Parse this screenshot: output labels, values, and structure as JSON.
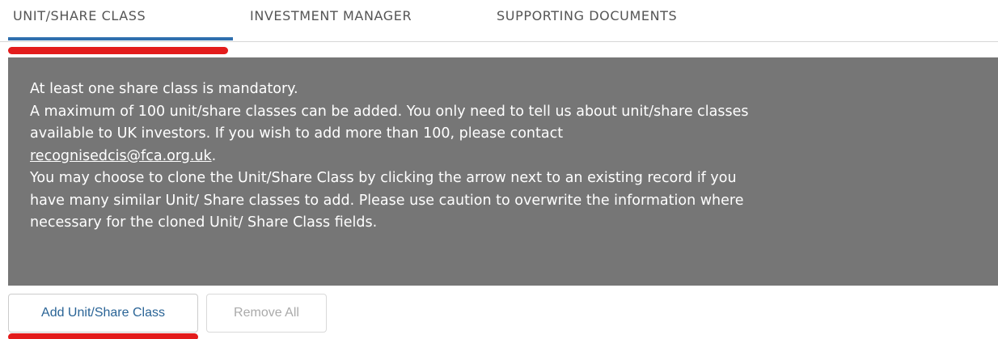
{
  "tabs": {
    "items": [
      {
        "label": "UNIT/SHARE CLASS",
        "active": true
      },
      {
        "label": "INVESTMENT MANAGER",
        "active": false
      },
      {
        "label": "SUPPORTING DOCUMENTS",
        "active": false
      }
    ]
  },
  "info": {
    "line1": "At least one share class is mandatory.",
    "line2": "A maximum of 100 unit/share classes can be added. You only need to tell us about unit/share classes",
    "line3": "available to UK investors. If you wish to add more than 100, please contact",
    "email": "recognisedcis@fca.org.uk",
    "email_suffix": ".",
    "line5": "You may choose to clone the Unit/Share Class by clicking the arrow next to an existing record if you",
    "line6": "have many similar Unit/ Share classes to add. Please use caution to overwrite the information where",
    "line7": "necessary for the cloned Unit/ Share Class fields."
  },
  "buttons": {
    "add_label": "Add Unit/Share Class",
    "remove_label": "Remove All"
  },
  "colors": {
    "active_tab_indicator": "#2f6fae",
    "annotation_highlight": "#e31c1c",
    "info_panel_bg": "#767676",
    "info_text": "#ffffff",
    "link_button_text": "#2a6496"
  }
}
